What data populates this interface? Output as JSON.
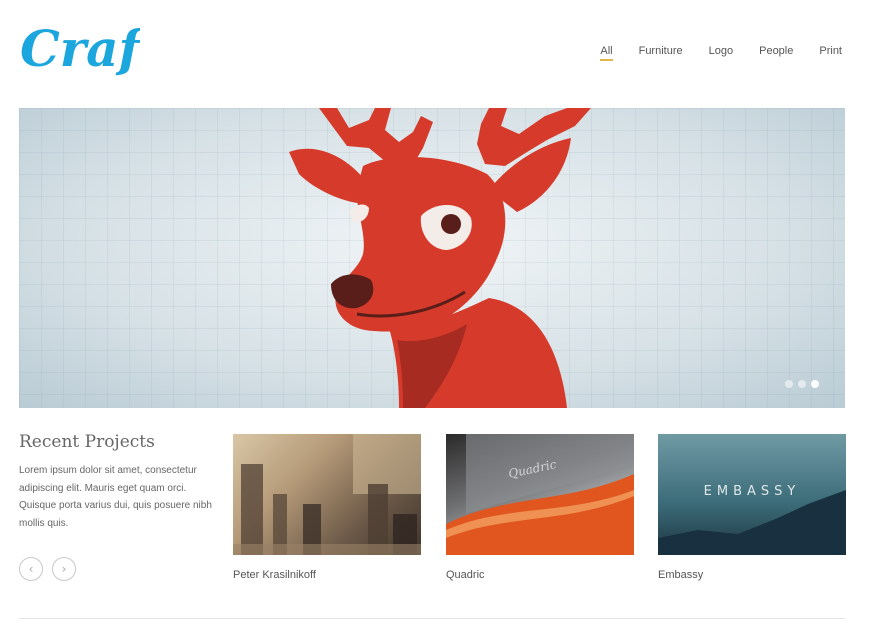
{
  "brand": {
    "logo_text": "Craft",
    "color": "#1ba6dd"
  },
  "nav": {
    "items": [
      {
        "label": "All",
        "active": true
      },
      {
        "label": "Furniture",
        "active": false
      },
      {
        "label": "Logo",
        "active": false
      },
      {
        "label": "People",
        "active": false
      },
      {
        "label": "Print",
        "active": false
      }
    ]
  },
  "hero": {
    "slide_count": 3,
    "active_slide": 3
  },
  "recent": {
    "title": "Recent Projects",
    "body": "Lorem ipsum dolor sit amet, consectetur adipiscing elit. Mauris eget quam orci. Quisque porta varius dui, quis posuere nibh mollis quis."
  },
  "projects": [
    {
      "caption": "Peter Krasilnikoff"
    },
    {
      "caption": "Quadric",
      "overlay_text": "Quadric"
    },
    {
      "caption": "Embassy",
      "overlay_text": "EMBASSY"
    }
  ],
  "controls": {
    "prev_icon": "‹",
    "next_icon": "›"
  }
}
